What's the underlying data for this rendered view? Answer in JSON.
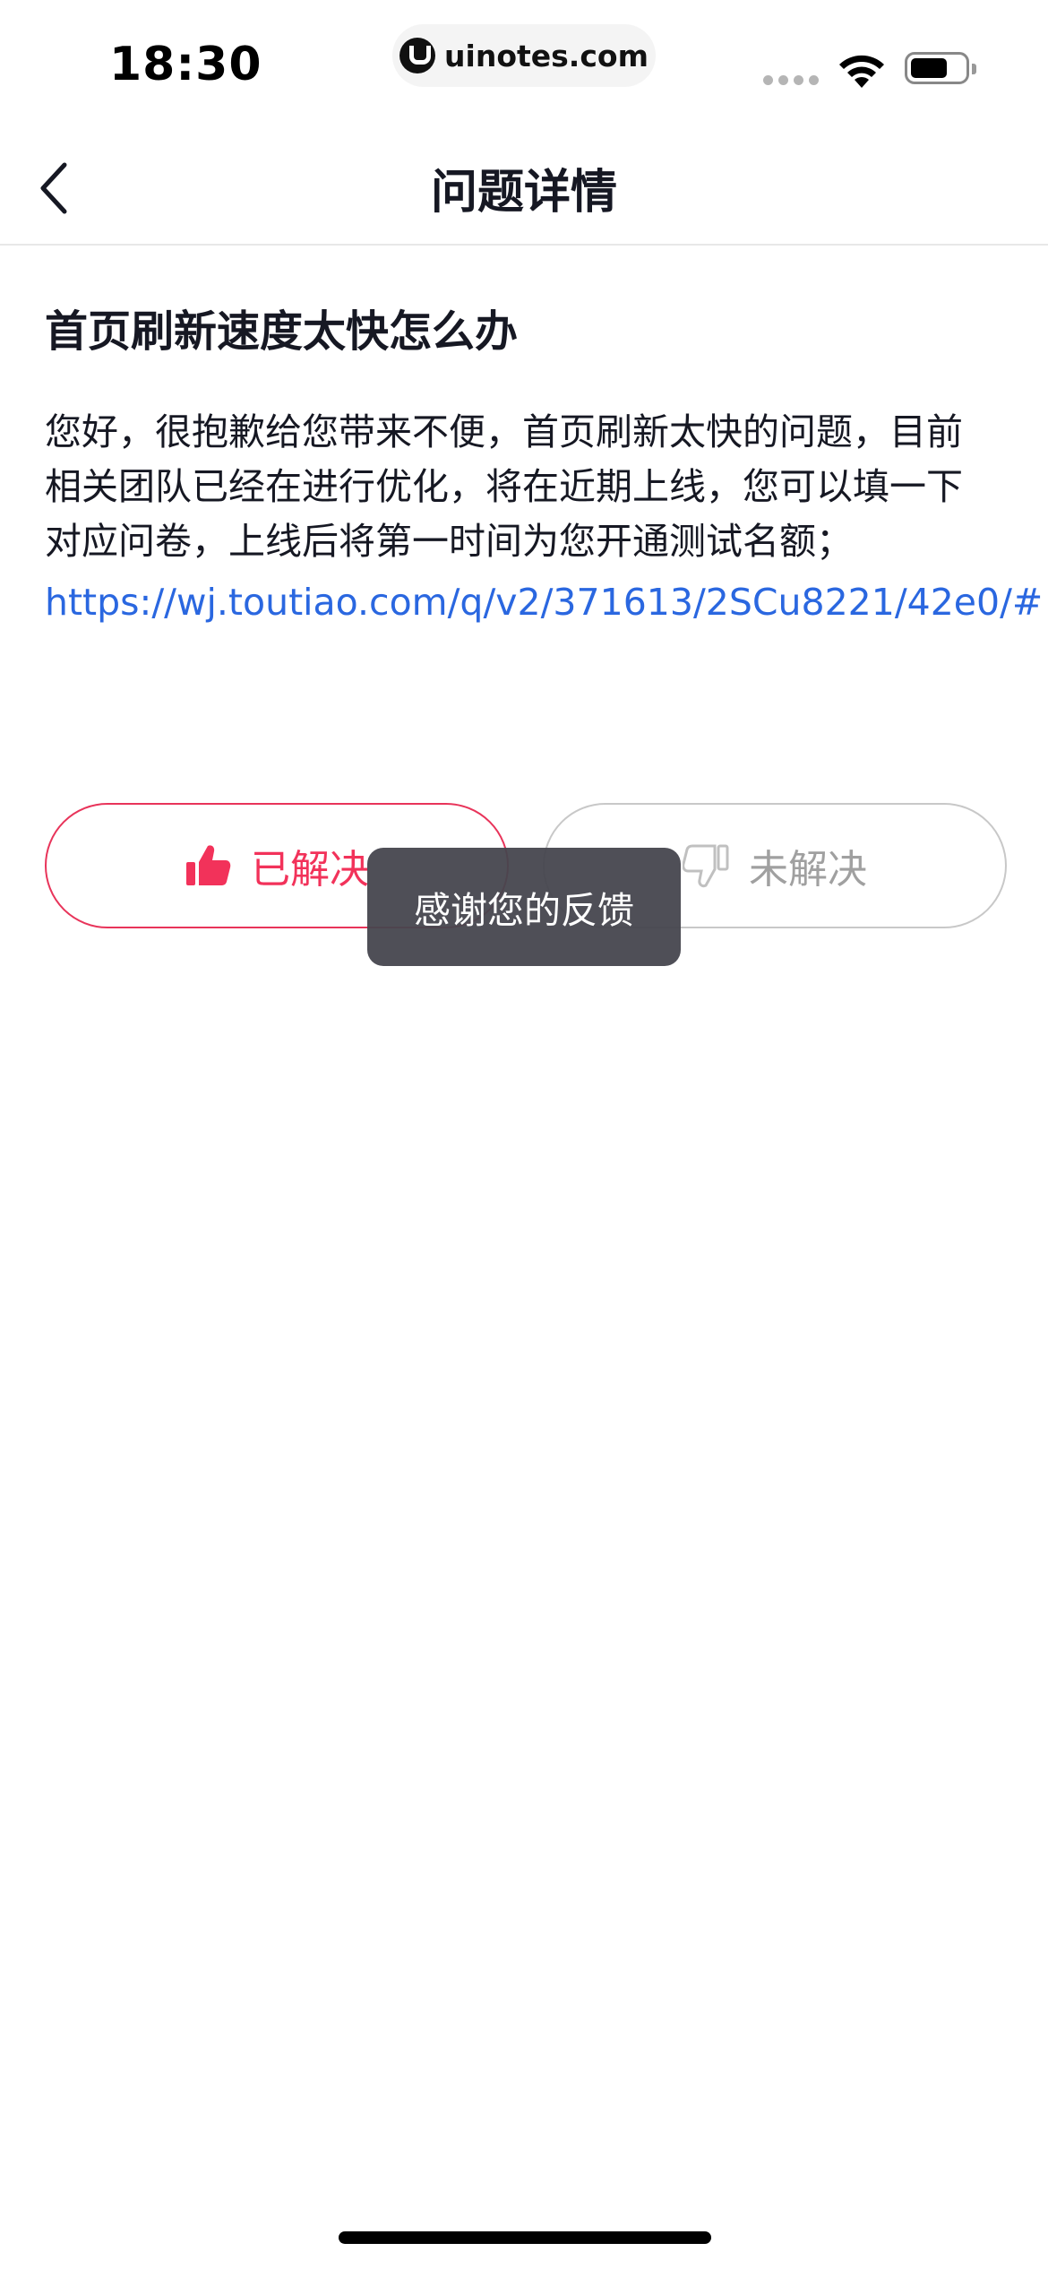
{
  "status_bar": {
    "time": "18:30",
    "url": "uinotes.com"
  },
  "nav": {
    "title": "问题详情",
    "back_icon": "chevron-left-icon"
  },
  "question": {
    "title": "首页刷新速度太快怎么办",
    "answer": "您好，很抱歉给您带来不便，首页刷新太快的问题，目前相关团队已经在进行优化，将在近期上线，您可以填一下对应问卷，上线后将第一时间为您开通测试名额；",
    "link": "https://wj.toutiao.com/q/v2/371613/2SCu8221/42e0/#"
  },
  "feedback": {
    "solved_label": "已解决",
    "solved_icon": "thumbs-up-icon",
    "unsolved_label": "未解决",
    "unsolved_icon": "thumbs-down-icon"
  },
  "toast": {
    "message": "感谢您的反馈"
  },
  "colors": {
    "accent": "#f2325a",
    "link": "#2a67e0",
    "text": "#161823",
    "muted": "#a0a0a0"
  }
}
